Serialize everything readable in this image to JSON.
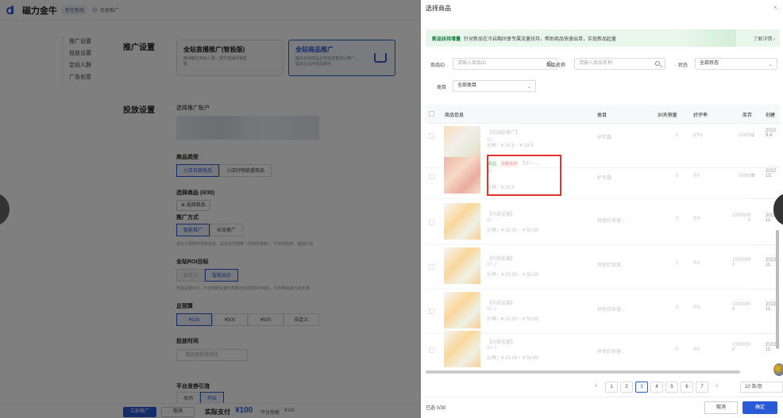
{
  "app": {
    "brand": "磁力金牛",
    "account_pill": "即往新版",
    "shop_label": "至极推广"
  },
  "left_nav": [
    "推广设置",
    "投放设置",
    "定向人群",
    "广告创意"
  ],
  "promo": {
    "section": "推广设置",
    "cards": [
      {
        "title": "全站直播推广(智投版)",
        "desc": "精准触达目标人群，提升直播间销售额"
      },
      {
        "title": "全站商品推广",
        "desc": "面向全站商品全自动流量进行推广，提高主站内商品曝光"
      }
    ]
  },
  "delivery": {
    "section": "投放设置",
    "account_label": "选择推广账户",
    "goods_type_label": "商品类型",
    "goods_type_options": [
      "小店自营商品",
      "小店好物联盟商品"
    ],
    "select_goods_label": "选择商品 (0/30)",
    "select_goods_btn": "选择商品",
    "method_label": "推广方式",
    "method_options": [
      "智能推广",
      "长效推广"
    ],
    "method_hint": "适合小预算的场景投放，需先支付预算（可用优惠券），不支持暂停、编辑计划",
    "roi_label": "全站ROI目标",
    "roi_options": [
      "自定义",
      "智能出价"
    ],
    "roi_hint": "无需设置ROI，平台根据设置的预算自动调控ROI目标，为你带来最大转化量",
    "budget_label": "总预算",
    "budget_options": [
      "¥100",
      "¥300",
      "¥500",
      "自定义"
    ],
    "time_label": "投放时间",
    "time_placeholder": "请选择投放时段",
    "coupon_label": "平台发券引流",
    "coupon_options": [
      "关闭",
      "开启"
    ]
  },
  "bottom": {
    "submit": "立即推广",
    "cancel": "取消",
    "pay_label": "实际支付",
    "pay_amount": "¥100",
    "platform_label": "平台垫解",
    "platform_amount": "¥100"
  },
  "drawer": {
    "title": "选择商品",
    "close": "×",
    "banner": {
      "title": "新品扶持增量",
      "text": "针对新品在冷启期间享专属流量扶持，帮助商品快速出单，实现新品起量",
      "link": "了解详情 ›"
    },
    "filters": {
      "product_id_label": "商品ID",
      "product_id_placeholder": "请输入商品ID",
      "name_label": "商品名称",
      "name_placeholder": "请输入商品名称",
      "status_label": "状态",
      "status_value": "全部状态",
      "category_label": "类目",
      "category_value": "全部类目"
    },
    "columns": [
      "商品信息",
      "类目",
      "30天销量",
      "好评率",
      "库存",
      "创建"
    ],
    "rows": [
      {
        "name": "【热销款推广】",
        "id": "ID:",
        "price": "价格：¥ 19.9 ~ ¥ 29.9",
        "category": "护手霜",
        "sales": "0",
        "rating": "83%",
        "stock": "199991",
        "created": "2022\n9:4"
      },
      {
        "tags": [
          "新品",
          "流量扶持"
        ],
        "name": "【买一...",
        "id": "ID:",
        "price": "价格：¥ 29.9",
        "category": "护手霜",
        "sales": "0",
        "rating": "0%",
        "stock": "999999",
        "created": "2022\n15:"
      },
      {
        "name": "【升级加量】",
        "id": "ID:",
        "price": "价格：¥ 39.99 ~ ¥ 59.99",
        "category": "其他饮食营...",
        "sales": "0",
        "rating": "0%",
        "stock": "1999999\n8",
        "created": "2022\n11:"
      },
      {
        "name": "【升级加量】",
        "id": "ID: 2",
        "price": "价格：¥ 39.99 ~ ¥ 59.99",
        "category": "其他饮食营...",
        "sales": "0",
        "rating": "0%",
        "stock": "1999999\n8",
        "created": "2022\n11:"
      },
      {
        "name": "【升级加量】",
        "id": "ID: 2",
        "price": "价格：¥ 39.99 ~ ¥ 59.99",
        "category": "其他饮食营...",
        "sales": "0",
        "rating": "0%",
        "stock": "1999999\n8",
        "created": "2022\n11:"
      },
      {
        "name": "【升级加量】",
        "id": "ID: 2",
        "price": "价格：¥ 39.99 ~ ¥ 59.99",
        "category": "其他饮食营...",
        "sales": "0",
        "rating": "0%",
        "stock": "1999999\n8",
        "created": "2022\n11:"
      }
    ],
    "pagination": {
      "prev": "‹",
      "pages": [
        "1",
        "2",
        "3",
        "4",
        "5",
        "6",
        "7"
      ],
      "current": "3",
      "next": "›",
      "size": "10 条/页"
    },
    "footer": {
      "selected": "已选 0/30",
      "cancel": "取消",
      "confirm": "确定"
    }
  }
}
